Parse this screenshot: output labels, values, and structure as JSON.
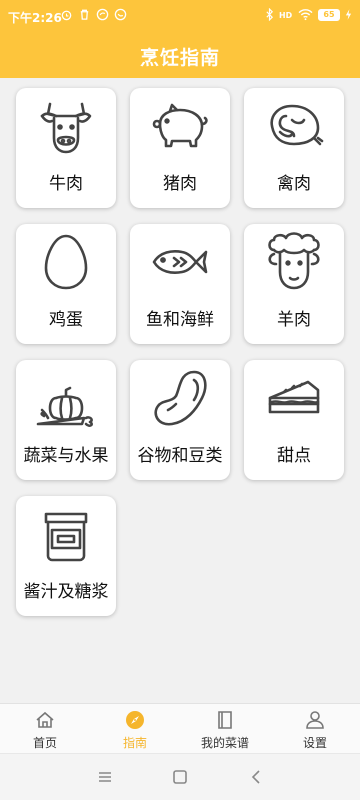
{
  "status_bar": {
    "time": "下午2:26",
    "battery": "65",
    "left_icons": [
      "alarm-icon",
      "trash-icon",
      "app-icon",
      "app-icon"
    ],
    "right_icons": [
      "bluetooth-icon",
      "hd-icon",
      "wifi-icon",
      "battery-icon"
    ]
  },
  "header": {
    "title": "烹饪指南",
    "color": "#fdc53c"
  },
  "categories": [
    {
      "label": "牛肉",
      "icon": "cow-icon"
    },
    {
      "label": "猪肉",
      "icon": "pig-icon"
    },
    {
      "label": "禽肉",
      "icon": "chicken-icon"
    },
    {
      "label": "鸡蛋",
      "icon": "egg-icon"
    },
    {
      "label": "鱼和海鲜",
      "icon": "fish-icon"
    },
    {
      "label": "羊肉",
      "icon": "sheep-icon"
    },
    {
      "label": "蔬菜与水果",
      "icon": "vegetables-icon"
    },
    {
      "label": "谷物和豆类",
      "icon": "bean-icon"
    },
    {
      "label": "甜点",
      "icon": "cake-icon"
    },
    {
      "label": "酱汁及糖浆",
      "icon": "jar-icon"
    }
  ],
  "tabbar": {
    "active": "指南",
    "active_color": "#f5b52c",
    "tabs": [
      {
        "label": "首页",
        "icon": "home-icon"
      },
      {
        "label": "指南",
        "icon": "compass-icon"
      },
      {
        "label": "我的菜谱",
        "icon": "book-icon"
      },
      {
        "label": "设置",
        "icon": "user-settings-icon"
      }
    ]
  },
  "system_nav": [
    "menu-icon",
    "home-square-icon",
    "back-icon"
  ]
}
